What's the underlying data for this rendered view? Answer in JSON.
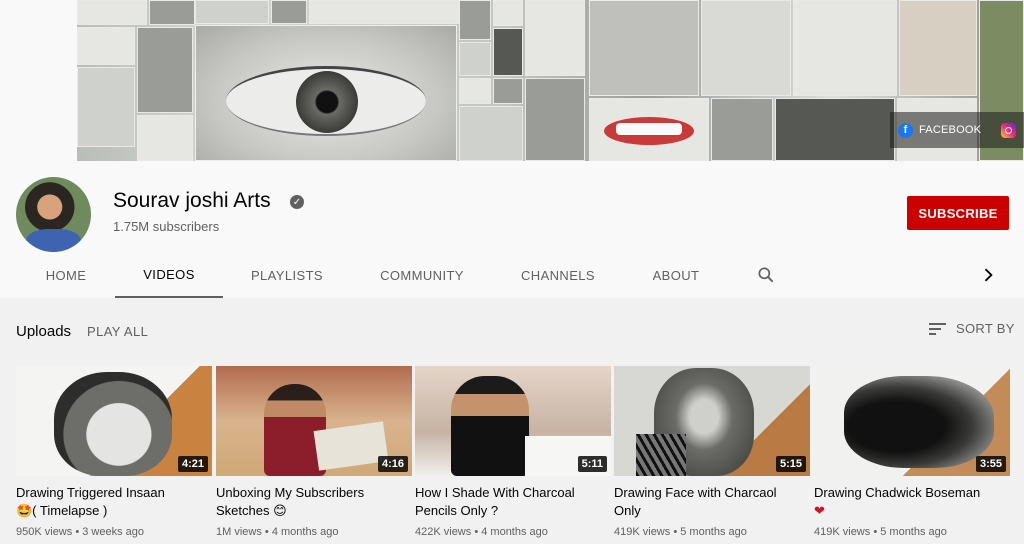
{
  "banner": {
    "social": {
      "facebook_label": "FACEBOOK"
    }
  },
  "channel": {
    "name": "Sourav joshi Arts",
    "subscribers": "1.75M subscribers",
    "subscribe_label": "SUBSCRIBE",
    "verified": true
  },
  "tabs": [
    {
      "label": "HOME",
      "active": false
    },
    {
      "label": "VIDEOS",
      "active": true
    },
    {
      "label": "PLAYLISTS",
      "active": false
    },
    {
      "label": "COMMUNITY",
      "active": false
    },
    {
      "label": "CHANNELS",
      "active": false
    },
    {
      "label": "ABOUT",
      "active": false
    }
  ],
  "section": {
    "title": "Uploads",
    "play_all": "PLAY ALL",
    "sort_label": "SORT BY"
  },
  "videos": [
    {
      "title": "Drawing Triggered Insaan",
      "title2": "🤩( Timelapse )",
      "duration": "4:21",
      "views": "950K views",
      "age": "3 weeks ago"
    },
    {
      "title": "Unboxing My Subscribers",
      "title2": "Sketches 😊",
      "duration": "4:16",
      "views": "1M views",
      "age": "4 months ago"
    },
    {
      "title": "How I Shade With Charcoal",
      "title2": "Pencils Only ?",
      "duration": "5:11",
      "views": "422K views",
      "age": "4 months ago"
    },
    {
      "title": "Drawing Face with Charcaol",
      "title2": "Only",
      "duration": "5:15",
      "views": "419K views",
      "age": "5 months ago"
    },
    {
      "title": "Drawing Chadwick Boseman",
      "title2": "❤",
      "duration": "3:55",
      "views": "419K views",
      "age": "5 months ago"
    }
  ],
  "colors": {
    "subscribe_bg": "#cc0000",
    "page_bg": "#f9f9f9",
    "content_bg": "#f1f1f1",
    "secondary_text": "#606060"
  }
}
